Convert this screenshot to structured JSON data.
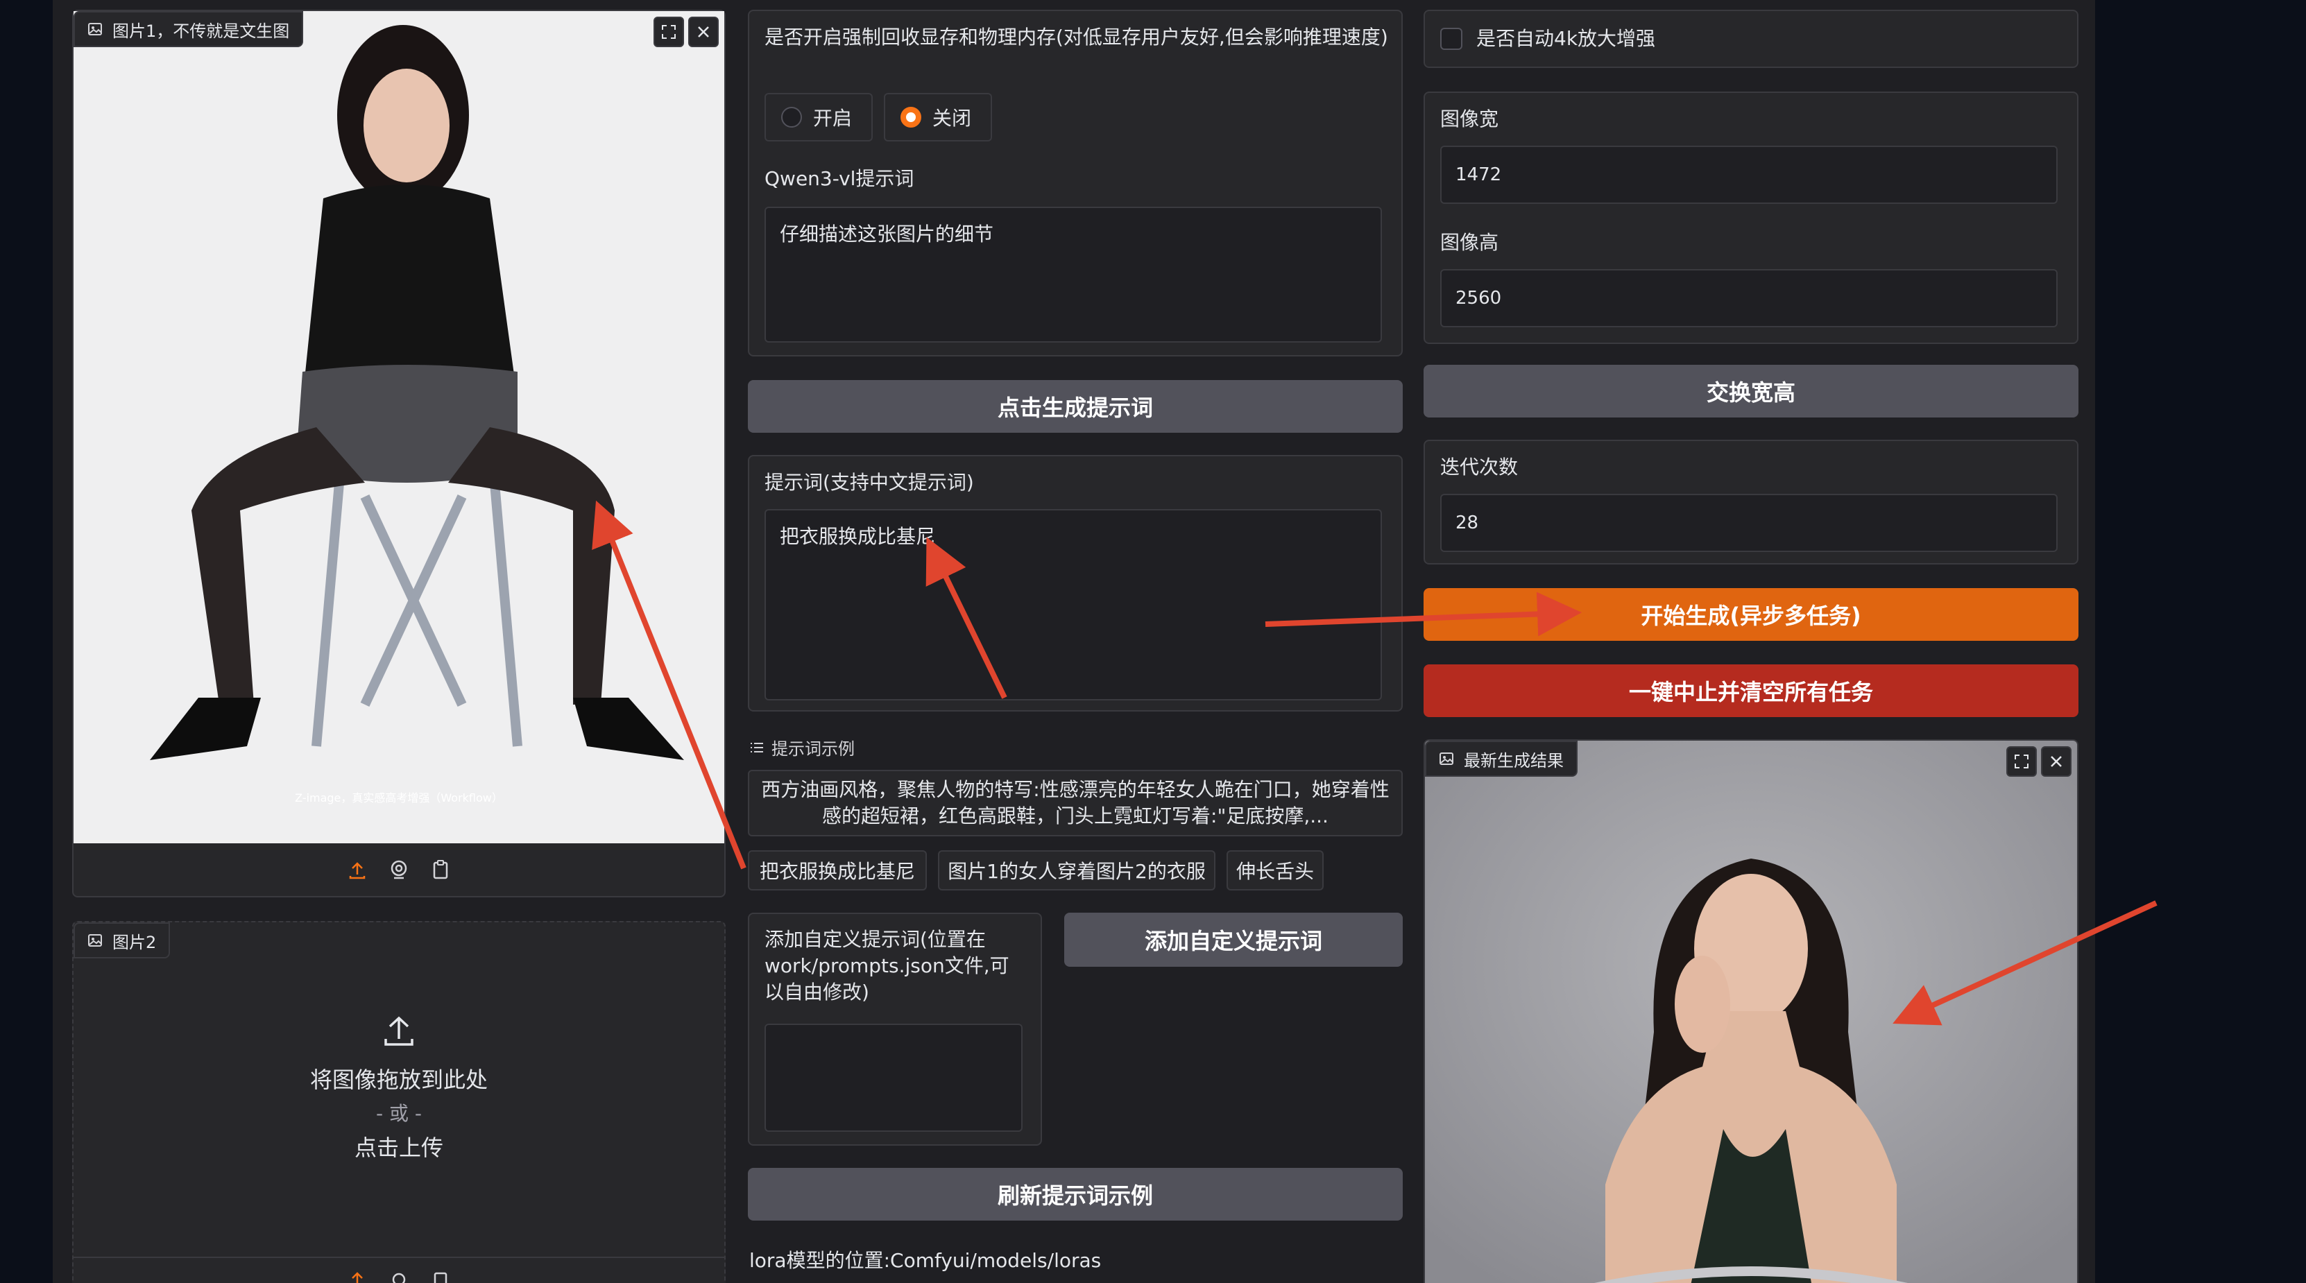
{
  "image1": {
    "label": "图片1，不传就是文生图",
    "watermark": "Z-image，真实感高考增强（Workflow）"
  },
  "image2": {
    "label": "图片2",
    "drop_text": "将图像拖放到此处",
    "or_text": "- 或 -",
    "click_text": "点击上传"
  },
  "memory": {
    "label": "是否开启强制回收显存和物理内存(对低显存用户友好,但会影响推理速度)",
    "options": [
      "开启",
      "关闭"
    ],
    "selected": "关闭"
  },
  "qwen": {
    "label": "Qwen3-vl提示词",
    "value": "仔细描述这张图片的细节"
  },
  "gen_prompt_button": "点击生成提示词",
  "prompt": {
    "label": "提示词(支持中文提示词)",
    "value": "把衣服换成比基尼"
  },
  "examples": {
    "label": "提示词示例",
    "items": [
      "西方油画风格，聚焦人物的特写:性感漂亮的年轻女人跪在门口，她穿着性感的超短裙，红色高跟鞋，门头上霓虹灯写着:\"足底按摩,...",
      "把衣服换成比基尼",
      "图片1的女人穿着图片2的衣服",
      "伸长舌头"
    ]
  },
  "custom": {
    "label": "添加自定义提示词(位置在work/prompts.json文件,可以自由修改)",
    "value": "",
    "button": "添加自定义提示词"
  },
  "refresh_button": "刷新提示词示例",
  "lora_text": "lora模型的位置:Comfyui/models/loras",
  "upscale": {
    "label": "是否自动4k放大增强",
    "checked": false
  },
  "width": {
    "label": "图像宽",
    "value": "1472"
  },
  "height": {
    "label": "图像高",
    "value": "2560"
  },
  "swap_button": "交换宽高",
  "steps": {
    "label": "迭代次数",
    "value": "28"
  },
  "start_button": "开始生成(异步多任务)",
  "stop_button": "一键中止并清空所有任务",
  "result": {
    "label": "最新生成结果"
  },
  "colors": {
    "accent": "#e06510",
    "danger": "#b52b1f",
    "annotation_arrow": "#e0452e"
  },
  "icons": [
    "image-icon",
    "fullscreen-icon",
    "close-icon",
    "upload-icon",
    "webcam-icon",
    "clipboard-icon",
    "list-icon"
  ]
}
